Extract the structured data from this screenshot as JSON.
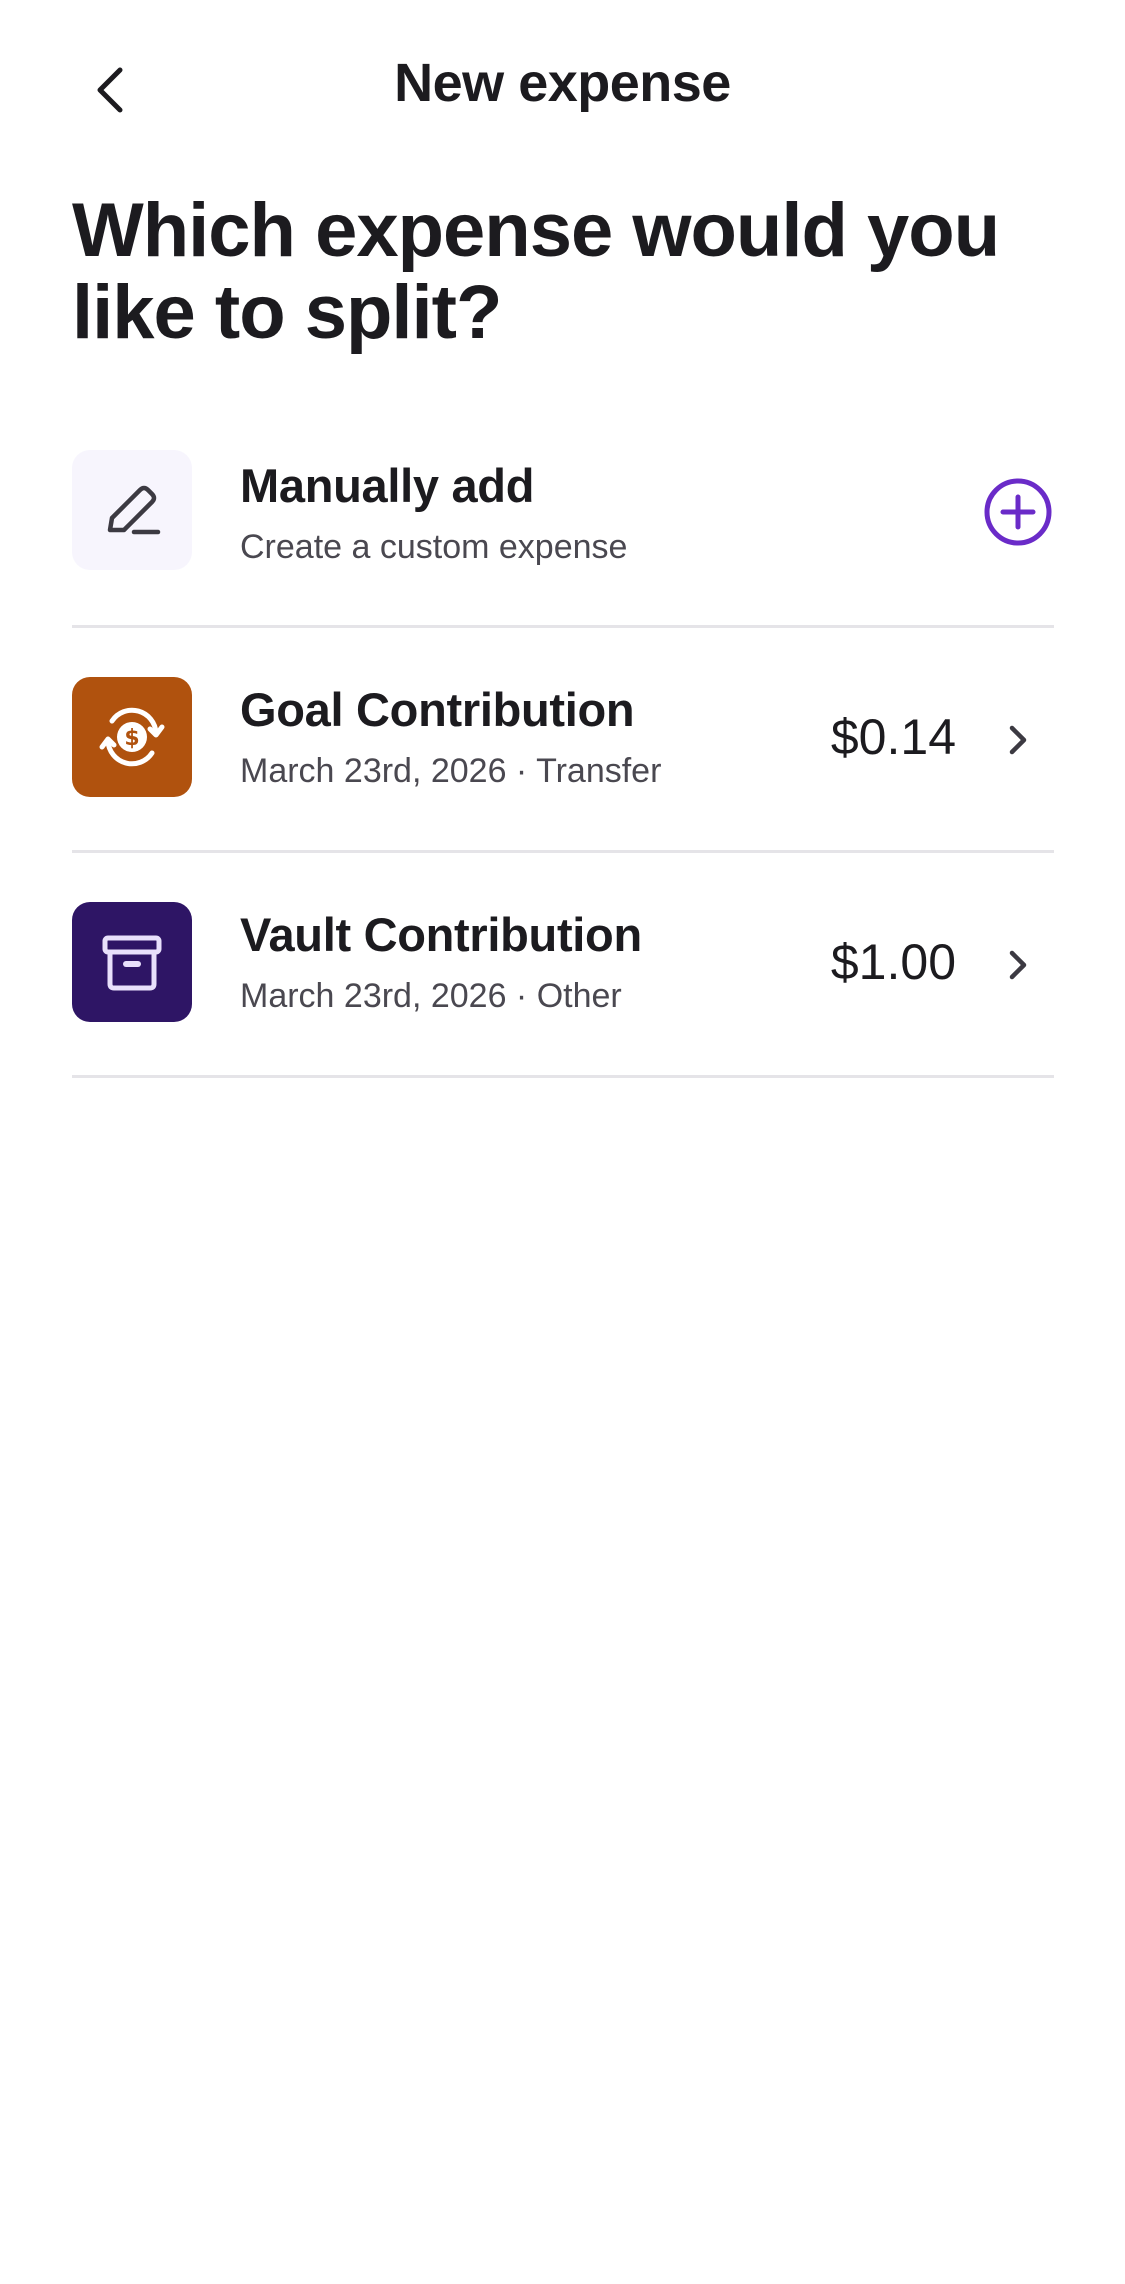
{
  "header": {
    "title": "New expense"
  },
  "heading": "Which expense would you like to split?",
  "manual_add": {
    "title": "Manually add",
    "subtitle": "Create a custom expense",
    "icon": "pencil-icon",
    "action_icon": "plus-circle-icon"
  },
  "expenses": [
    {
      "title": "Goal Contribution",
      "subtitle": "March 23rd, 2026 · Transfer",
      "amount": "$0.14",
      "icon": "dollar-cycle-icon",
      "icon_bg": "#b0520e"
    },
    {
      "title": "Vault Contribution",
      "subtitle": "March 23rd, 2026 · Other",
      "amount": "$1.00",
      "icon": "archive-box-icon",
      "icon_bg": "#2e1565"
    }
  ],
  "colors": {
    "accent": "#6a2bc8",
    "text": "#1c1b1f",
    "divider": "#e5e4e8"
  }
}
